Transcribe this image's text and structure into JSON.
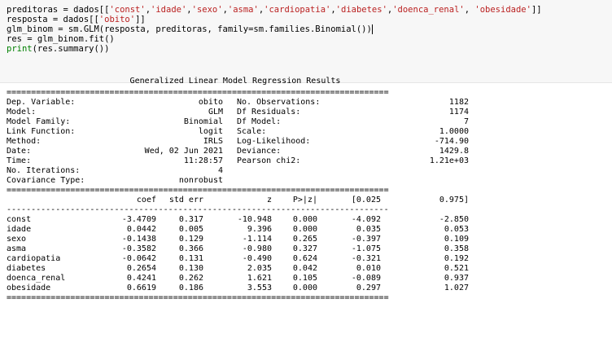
{
  "code": {
    "line1": {
      "a": "preditoras = dados[[",
      "s1": "'const'",
      "c1": ",",
      "s2": "'idade'",
      "c2": ",",
      "s3": "'sexo'",
      "c3": ",",
      "s4": "'asma'",
      "c4": ",",
      "s5": "'cardiopatia'",
      "c5": ",",
      "s6": "'diabetes'",
      "c6": ",",
      "s7": "'doenca_renal'",
      "c7": ", ",
      "s8": "'obesidade'",
      "end": "]]"
    },
    "line2": {
      "a": "resposta = dados[[",
      "s": "'obito'",
      "end": "]]"
    },
    "line3": {
      "text": "glm_binom = sm.GLM(resposta, preditoras, family=sm.families.Binomial())"
    },
    "line4": {
      "text": "res = glm_binom.fit()"
    },
    "line5": {
      "kw": "print",
      "rest": "(res.summary())"
    }
  },
  "summary": {
    "title": "Generalized Linear Model Regression Results",
    "rule_double": "==============================================================================",
    "rule_single": "------------------------------------------------------------------------------",
    "info_left": [
      {
        "label": "Dep. Variable:",
        "value": "obito"
      },
      {
        "label": "Model:",
        "value": "GLM"
      },
      {
        "label": "Model Family:",
        "value": "Binomial"
      },
      {
        "label": "Link Function:",
        "value": "logit"
      },
      {
        "label": "Method:",
        "value": "IRLS"
      },
      {
        "label": "Date:",
        "value": "Wed, 02 Jun 2021"
      },
      {
        "label": "Time:",
        "value": "11:28:57"
      },
      {
        "label": "No. Iterations:",
        "value": "4"
      },
      {
        "label": "Covariance Type:",
        "value": "nonrobust"
      }
    ],
    "info_right": [
      {
        "label": "No. Observations:",
        "value": "1182"
      },
      {
        "label": "Df Residuals:",
        "value": "1174"
      },
      {
        "label": "Df Model:",
        "value": "7"
      },
      {
        "label": "Scale:",
        "value": "1.0000"
      },
      {
        "label": "Log-Likelihood:",
        "value": "-714.90"
      },
      {
        "label": "Deviance:",
        "value": "1429.8"
      },
      {
        "label": "Pearson chi2:",
        "value": "1.21e+03"
      }
    ],
    "columns": [
      "coef",
      "std err",
      "z",
      "P>|z|",
      "[0.025",
      "0.975]"
    ],
    "rows": [
      {
        "name": "const",
        "vals": [
          "-3.4709",
          "0.317",
          "-10.948",
          "0.000",
          "-4.092",
          "-2.850"
        ]
      },
      {
        "name": "idade",
        "vals": [
          "0.0442",
          "0.005",
          "9.396",
          "0.000",
          "0.035",
          "0.053"
        ]
      },
      {
        "name": "sexo",
        "vals": [
          "-0.1438",
          "0.129",
          "-1.114",
          "0.265",
          "-0.397",
          "0.109"
        ]
      },
      {
        "name": "asma",
        "vals": [
          "-0.3582",
          "0.366",
          "-0.980",
          "0.327",
          "-1.075",
          "0.358"
        ]
      },
      {
        "name": "cardiopatia",
        "vals": [
          "-0.0642",
          "0.131",
          "-0.490",
          "0.624",
          "-0.321",
          "0.192"
        ]
      },
      {
        "name": "diabetes",
        "vals": [
          "0.2654",
          "0.130",
          "2.035",
          "0.042",
          "0.010",
          "0.521"
        ]
      },
      {
        "name": "doenca_renal",
        "vals": [
          "0.4241",
          "0.262",
          "1.621",
          "0.105",
          "-0.089",
          "0.937"
        ]
      },
      {
        "name": "obesidade",
        "vals": [
          "0.6619",
          "0.186",
          "3.553",
          "0.000",
          "0.297",
          "1.027"
        ]
      }
    ]
  }
}
